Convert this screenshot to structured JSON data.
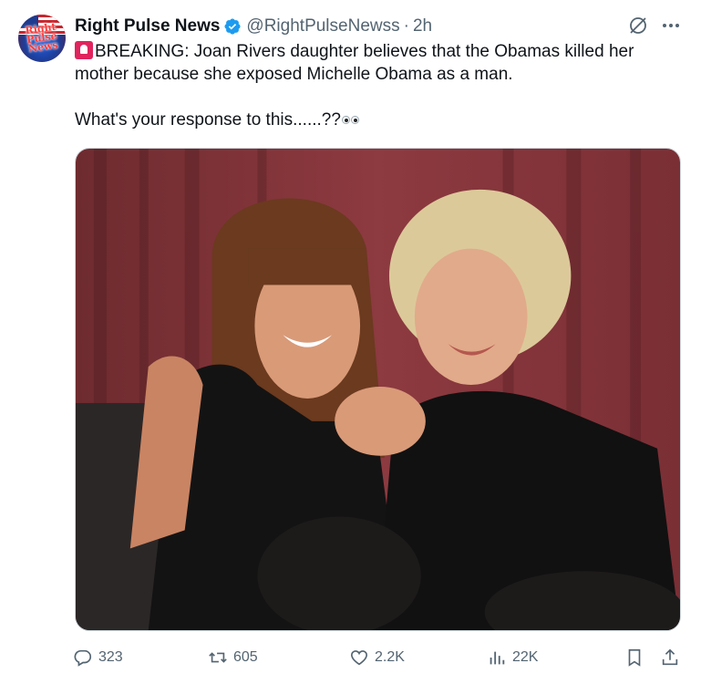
{
  "tweet": {
    "author_name": "Right Pulse News",
    "handle": "@RightPulseNewss",
    "separator": "·",
    "time": "2h",
    "avatar_text": "Right Pulse News",
    "line1": "BREAKING: Joan Rivers daughter believes that the Obamas killed her mother because she exposed Michelle Obama as a man.",
    "line2": "What's your response to this......??",
    "media_alt_icons": [
      "siren-emoji-icon",
      "eyes-emoji-icon"
    ]
  },
  "actions": {
    "replies": "323",
    "reposts": "605",
    "likes": "2.2K",
    "views": "22K"
  },
  "colors": {
    "text": "#0f1419",
    "secondary": "#536471",
    "verified": "#1d9bf0",
    "media_background": "#8a3a3e"
  },
  "icons": {
    "verified": "verified-badge-icon",
    "grok": "grok-icon",
    "more": "more-icon",
    "reply": "reply-icon",
    "repost": "repost-icon",
    "like": "heart-icon",
    "views": "views-icon",
    "bookmark": "bookmark-icon",
    "share": "share-icon"
  }
}
